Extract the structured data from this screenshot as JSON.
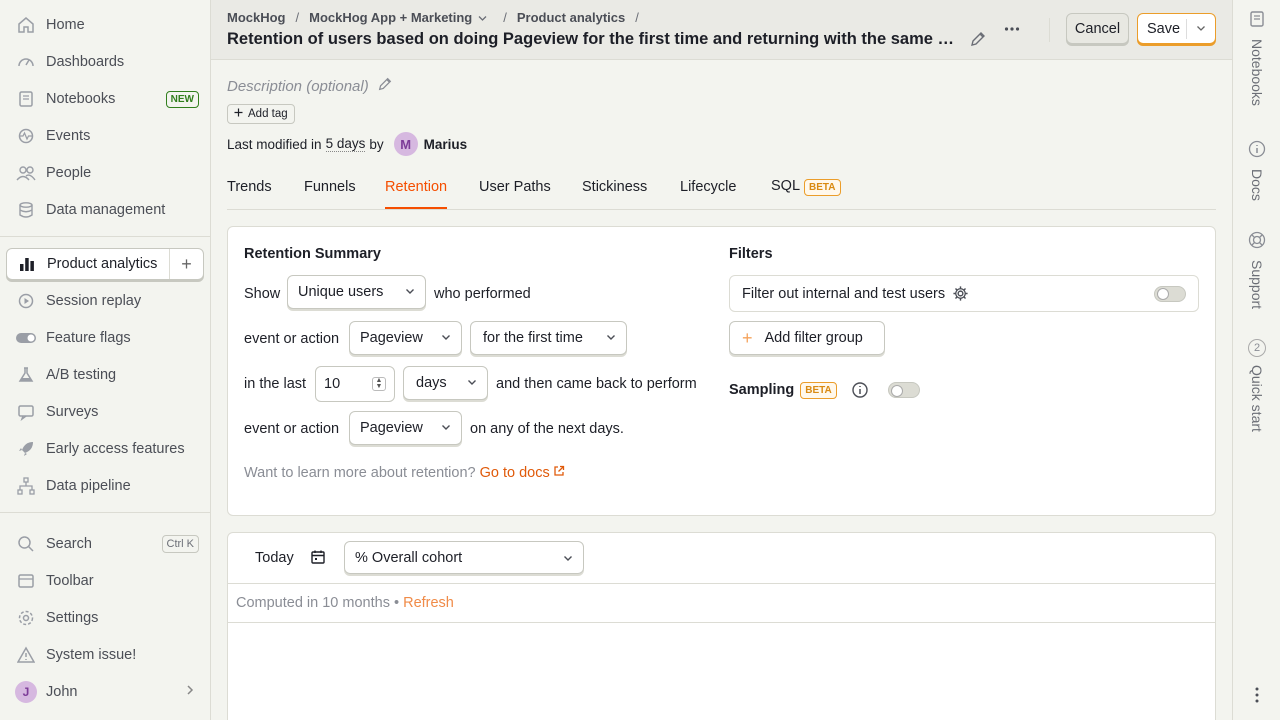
{
  "sidebar": {
    "items": [
      {
        "label": "Home",
        "icon": "home-icon"
      },
      {
        "label": "Dashboards",
        "icon": "dashboard-icon"
      },
      {
        "label": "Notebooks",
        "icon": "notebook-icon",
        "badge": "NEW"
      },
      {
        "label": "Events",
        "icon": "events-icon"
      },
      {
        "label": "People",
        "icon": "people-icon"
      },
      {
        "label": "Data management",
        "icon": "database-icon"
      },
      {
        "label": "Product analytics",
        "icon": "bar-chart-icon"
      },
      {
        "label": "Session replay",
        "icon": "replay-icon"
      },
      {
        "label": "Feature flags",
        "icon": "toggle-icon"
      },
      {
        "label": "A/B testing",
        "icon": "flask-icon"
      },
      {
        "label": "Surveys",
        "icon": "survey-icon"
      },
      {
        "label": "Early access features",
        "icon": "rocket-icon"
      },
      {
        "label": "Data pipeline",
        "icon": "pipeline-icon"
      },
      {
        "label": "Search",
        "icon": "search-icon",
        "shortcut": "Ctrl K"
      },
      {
        "label": "Toolbar",
        "icon": "toolbar-icon"
      },
      {
        "label": "Settings",
        "icon": "gear-icon"
      },
      {
        "label": "System issue!",
        "icon": "warning-icon"
      }
    ],
    "user": {
      "initial": "J",
      "name": "John"
    }
  },
  "rail": {
    "items": [
      {
        "label": "Notebooks",
        "icon": "notebook-icon"
      },
      {
        "label": "Docs",
        "icon": "info-icon"
      },
      {
        "label": "Support",
        "icon": "lifebuoy-icon"
      },
      {
        "label": "Quick start",
        "badge": "2"
      }
    ]
  },
  "header": {
    "breadcrumbs": [
      "MockHog",
      "MockHog App + Marketing",
      "Product analytics"
    ],
    "title": "Retention of users based on doing Pageview for the first time and returning with the same event",
    "cancel_label": "Cancel",
    "save_label": "Save"
  },
  "meta": {
    "description_placeholder": "Description (optional)",
    "add_tag_label": "Add tag",
    "modified_prefix": "Last modified in",
    "modified_when": "5 days",
    "modified_by": "by",
    "author_initial": "M",
    "author_name": "Marius"
  },
  "tabs": [
    {
      "label": "Trends"
    },
    {
      "label": "Funnels"
    },
    {
      "label": "Retention",
      "active": true
    },
    {
      "label": "User Paths"
    },
    {
      "label": "Stickiness"
    },
    {
      "label": "Lifecycle"
    },
    {
      "label": "SQL",
      "badge": "BETA"
    }
  ],
  "summary": {
    "title": "Retention Summary",
    "show_label": "Show",
    "show_value": "Unique users",
    "performed_label": "who performed",
    "event_label": "event or action",
    "event_value": "Pageview",
    "first_time_value": "for the first time",
    "in_last_label": "in the last",
    "period_count": "10",
    "period_unit": "days",
    "came_back_label": "and then came back to perform",
    "event2_label": "event or action",
    "event2_value": "Pageview",
    "next_days_label": "on any of the next days.",
    "learn_text": "Want to learn more about retention?",
    "docs_link": "Go to docs"
  },
  "filters": {
    "title": "Filters",
    "internal_label": "Filter out internal and test users",
    "internal_enabled": false,
    "add_group_label": "Add filter group",
    "sampling_label": "Sampling",
    "sampling_badge": "BETA",
    "sampling_enabled": false
  },
  "results": {
    "date_label": "Today",
    "display_value": "% Overall cohort",
    "computed_text": "Computed in 10 months",
    "bullet": "•",
    "refresh_label": "Refresh"
  },
  "colors": {
    "accent": "#f54e00",
    "save_border": "#eb9d2a",
    "beta": "#d98a12"
  }
}
